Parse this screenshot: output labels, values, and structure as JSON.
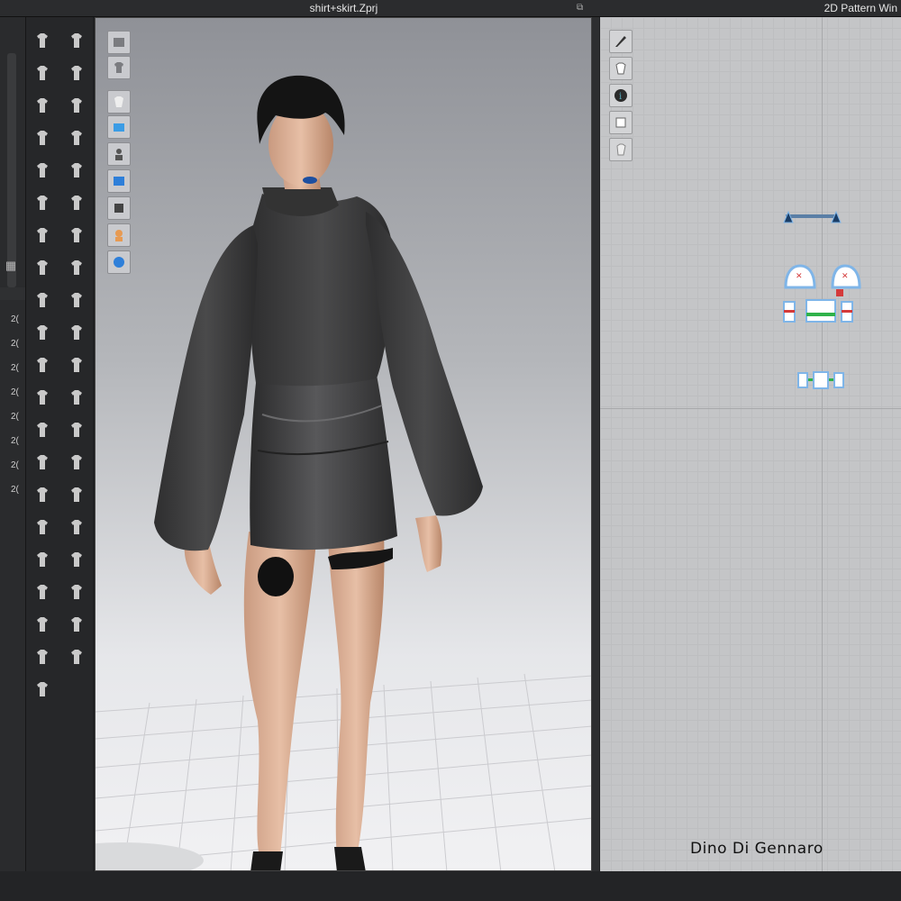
{
  "window": {
    "viewport_3d_title": "shirt+skirt.Zprj",
    "viewport_2d_title": "2D Pattern Win"
  },
  "left_panel": {
    "row_labels": [
      "2(",
      "2(",
      "2(",
      "2(",
      "2(",
      "2(",
      "2(",
      "2("
    ]
  },
  "toolbar_3d": {
    "icons": [
      "down-arrow-icon",
      "walk-avatar-icon",
      "transform-icon",
      "move-arrow-icon",
      "select-mesh-icon",
      "pin-icon",
      "box-select-icon",
      "brush-icon",
      "shirt-icon",
      "shirt-tuck-icon",
      "shirt-front-icon",
      "shirt-fold-icon",
      "shirt-layer-icon",
      "shirt-stack-icon",
      "shirt-sew-icon",
      "measure-icon",
      "sew-machine-icon",
      "multi-sew-icon",
      "segment-sew-icon",
      "tack-icon",
      "connect-icon",
      "button-icon",
      "pen-icon",
      "line-icon",
      "scissors-icon",
      "lock-icon",
      "fold-icon",
      "zip-icon",
      "cap-icon",
      "pattern-icon",
      "avatar-fit-icon",
      "texture-icon",
      "shirt-outline-icon",
      "fabric-icon",
      "overlay-icon",
      "grid-icon",
      "figure-icon",
      "tone-icon",
      "shirt-up-icon",
      "arrow-split-icon",
      "shirt-down-icon"
    ]
  },
  "viewport_3d": {
    "side_icons": [
      "3d-view-icon",
      "shirt-view-icon",
      "garment-visibility-icon",
      "wireframe-icon",
      "avatar-visibility-icon",
      "texture-view-icon",
      "surface-icon",
      "skin-icon",
      "globe-icon"
    ]
  },
  "viewport_2d": {
    "side_icons": [
      "pen-tool-icon",
      "shirt-view-icon",
      "info-icon",
      "layer-icon",
      "lock-shirt-icon"
    ]
  },
  "watermark": "Dino Di Gennaro",
  "colors": {
    "accent_blue": "#2e7fd9",
    "panel_dark": "#262729",
    "seam_red": "#d43a3a",
    "seam_green": "#2fb24a"
  }
}
